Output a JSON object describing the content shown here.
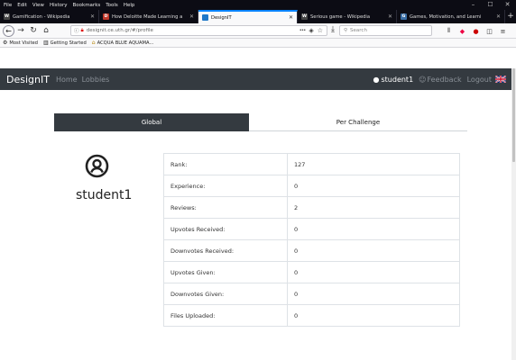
{
  "browser": {
    "menu": [
      "File",
      "Edit",
      "View",
      "History",
      "Bookmarks",
      "Tools",
      "Help"
    ],
    "tabs": [
      {
        "title": "Gamification - Wikipedia",
        "favicon": "W",
        "favicon_color": "#444"
      },
      {
        "title": "How Deloitte Made Learning a",
        "favicon": "D",
        "favicon_color": "#c0392b"
      },
      {
        "title": "DesignIT",
        "favicon": "",
        "favicon_color": "#1f78c8",
        "active": true
      },
      {
        "title": "Serious game - Wikipedia",
        "favicon": "W",
        "favicon_color": "#444"
      },
      {
        "title": "Games, Motivation, and Learni",
        "favicon": "G",
        "favicon_color": "#3a6ea5"
      }
    ],
    "url": "designit.ce.uth.gr/#/profile",
    "search_placeholder": "Search",
    "bookmarks": [
      {
        "label": "Most Visited",
        "icon": "gear-icon"
      },
      {
        "label": "Getting Started",
        "icon": "book-icon"
      },
      {
        "label": "ACQUA BLUE AQUAMA...",
        "icon": "home-icon"
      }
    ]
  },
  "app": {
    "brand": "DesignIT",
    "nav": [
      "Home",
      "Lobbies"
    ],
    "user": "student1",
    "feedback": "Feedback",
    "logout": "Logout",
    "nav_bg": "#343a40"
  },
  "profile": {
    "tabs": {
      "global": "Global",
      "per_challenge": "Per Challenge",
      "active": "global"
    },
    "username": "student1",
    "stats": [
      {
        "label": "Rank:",
        "value": "127"
      },
      {
        "label": "Experience:",
        "value": "0"
      },
      {
        "label": "Reviews:",
        "value": "2"
      },
      {
        "label": "Upvotes Received:",
        "value": "0"
      },
      {
        "label": "Downvotes Received:",
        "value": "0"
      },
      {
        "label": "Upvotes Given:",
        "value": "0"
      },
      {
        "label": "Downvotes Given:",
        "value": "0"
      },
      {
        "label": "Files Uploaded:",
        "value": "0"
      }
    ]
  }
}
